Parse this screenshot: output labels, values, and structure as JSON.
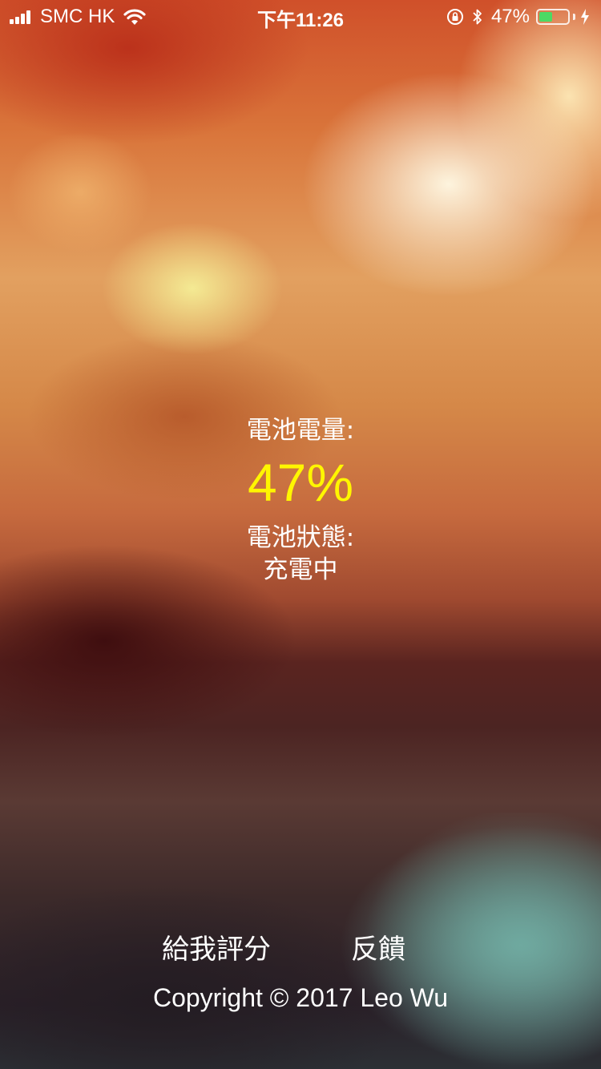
{
  "status_bar": {
    "carrier": "SMC HK",
    "time": "下午11:26",
    "battery_percent_text": "47%",
    "battery_level": 0.47,
    "icons": [
      "signal-icon",
      "wifi-icon",
      "rotation-lock-icon",
      "bluetooth-icon",
      "battery-icon",
      "charging-bolt-icon"
    ]
  },
  "battery": {
    "level_label": "電池電量:",
    "level_value": "47%",
    "status_label": "電池狀態:",
    "status_value": "充電中"
  },
  "footer": {
    "rate_label": "給我評分",
    "feedback_label": "反饋",
    "copyright": "Copyright © 2017 Leo Wu"
  },
  "colors": {
    "level_value": "#fff600",
    "text": "#ffffff",
    "battery_fill": "#4cd964"
  }
}
